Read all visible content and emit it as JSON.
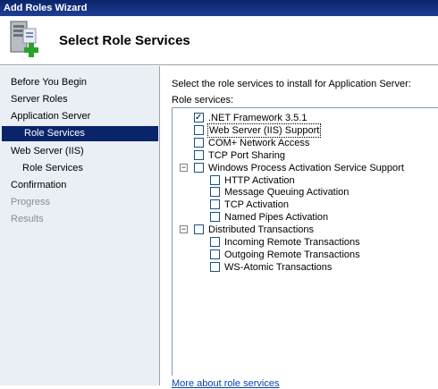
{
  "window": {
    "title": "Add Roles Wizard"
  },
  "header": {
    "title": "Select Role Services",
    "icon": "server-add-icon"
  },
  "nav": {
    "items": [
      {
        "label": "Before You Begin",
        "state": "normal",
        "indent": false
      },
      {
        "label": "Server Roles",
        "state": "normal",
        "indent": false
      },
      {
        "label": "Application Server",
        "state": "normal",
        "indent": false
      },
      {
        "label": "Role Services",
        "state": "selected",
        "indent": true
      },
      {
        "label": "Web Server (IIS)",
        "state": "normal",
        "indent": false
      },
      {
        "label": "Role Services",
        "state": "normal",
        "indent": true
      },
      {
        "label": "Confirmation",
        "state": "normal",
        "indent": false
      },
      {
        "label": "Progress",
        "state": "disabled",
        "indent": false
      },
      {
        "label": "Results",
        "state": "disabled",
        "indent": false
      }
    ]
  },
  "content": {
    "description": "Select the role services to install for Application Server:",
    "role_services_label": "Role services:",
    "tree": [
      {
        "label": ".NET Framework 3.5.1",
        "checked": true,
        "level": 0,
        "expander": ""
      },
      {
        "label": "Web Server (IIS) Support",
        "checked": false,
        "level": 0,
        "expander": "",
        "focused": true
      },
      {
        "label": "COM+ Network Access",
        "checked": false,
        "level": 0,
        "expander": ""
      },
      {
        "label": "TCP Port Sharing",
        "checked": false,
        "level": 0,
        "expander": ""
      },
      {
        "label": "Windows Process Activation Service Support",
        "checked": false,
        "level": 0,
        "expander": "−"
      },
      {
        "label": "HTTP Activation",
        "checked": false,
        "level": 1,
        "expander": ""
      },
      {
        "label": "Message Queuing Activation",
        "checked": false,
        "level": 1,
        "expander": ""
      },
      {
        "label": "TCP Activation",
        "checked": false,
        "level": 1,
        "expander": ""
      },
      {
        "label": "Named Pipes Activation",
        "checked": false,
        "level": 1,
        "expander": ""
      },
      {
        "label": "Distributed Transactions",
        "checked": false,
        "level": 0,
        "expander": "−"
      },
      {
        "label": "Incoming Remote Transactions",
        "checked": false,
        "level": 1,
        "expander": ""
      },
      {
        "label": "Outgoing Remote Transactions",
        "checked": false,
        "level": 1,
        "expander": ""
      },
      {
        "label": "WS-Atomic Transactions",
        "checked": false,
        "level": 1,
        "expander": ""
      }
    ],
    "more_link": "More about role services"
  }
}
